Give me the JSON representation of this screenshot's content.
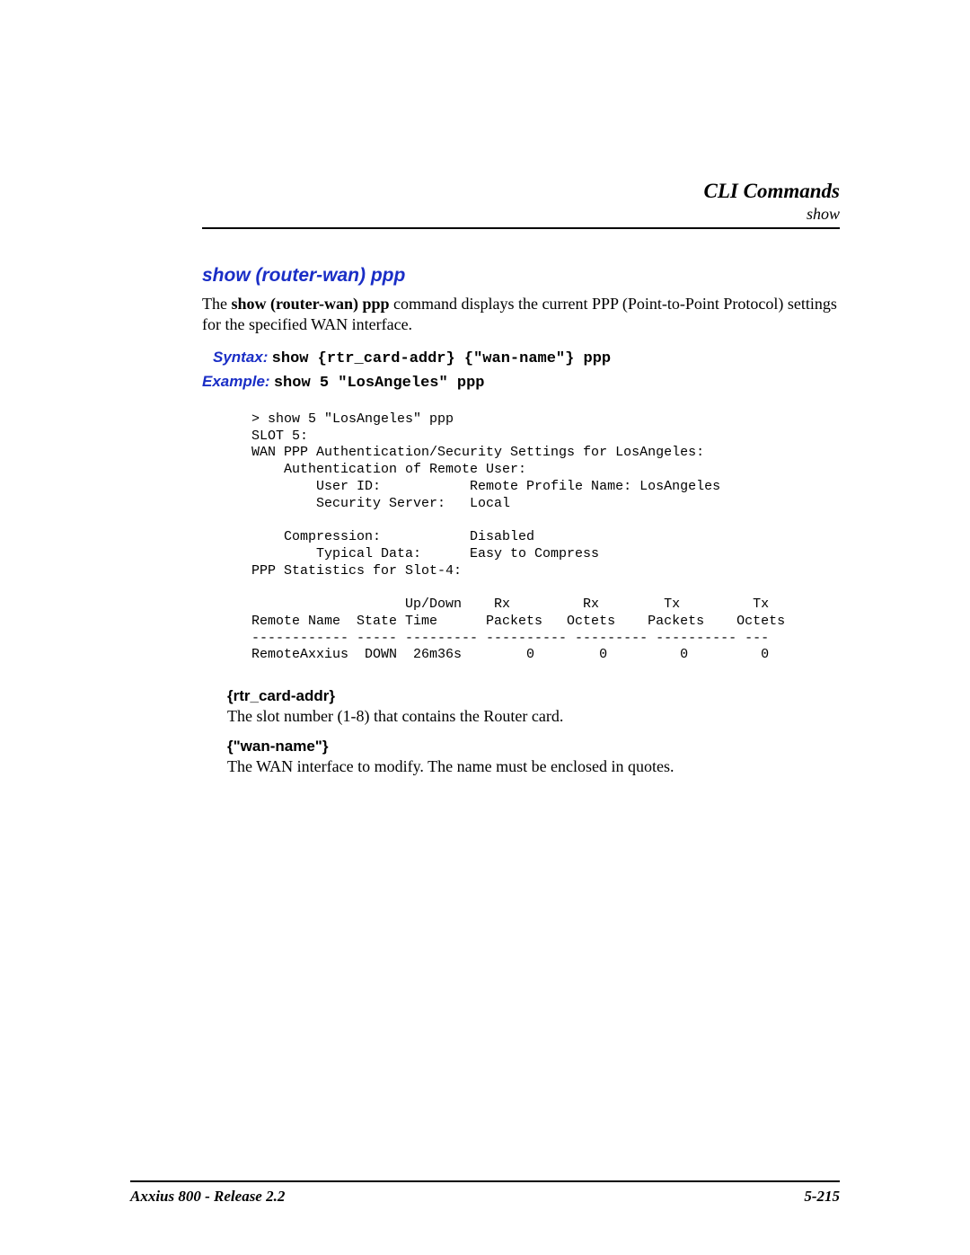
{
  "header": {
    "title": "CLI Commands",
    "subtitle": "show"
  },
  "section": {
    "title": "show (router-wan) ppp",
    "intro_pre": "The ",
    "intro_bold": "show (router-wan) ppp",
    "intro_post": " command displays the current PPP (Point-to-Point Protocol) settings for the specified WAN interface.",
    "syntax_label": "Syntax:",
    "syntax_cmd": "show {rtr_card-addr} {\"wan-name\"} ppp",
    "example_label": "Example:",
    "example_cmd": "show 5 \"LosAngeles\" ppp",
    "output_block": "> show 5 \"LosAngeles\" ppp\nSLOT 5:\nWAN PPP Authentication/Security Settings for LosAngeles:\n    Authentication of Remote User:\n        User ID:           Remote Profile Name: LosAngeles\n        Security Server:   Local\n\n    Compression:           Disabled\n        Typical Data:      Easy to Compress\nPPP Statistics for Slot-4:\n\n                   Up/Down    Rx         Rx        Tx         Tx\nRemote Name  State Time      Packets   Octets    Packets    Octets\n------------ ----- --------- ---------- --------- ---------- ---\nRemoteAxxius  DOWN  26m36s        0        0         0         0",
    "params": [
      {
        "name": "{rtr_card-addr}",
        "desc": "The slot number (1-8) that contains the Router card."
      },
      {
        "name": "{\"wan-name\"}",
        "desc": "The WAN interface to modify. The name must be enclosed in quotes."
      }
    ]
  },
  "footer": {
    "left": "Axxius 800 - Release 2.2",
    "right": "5-215"
  }
}
